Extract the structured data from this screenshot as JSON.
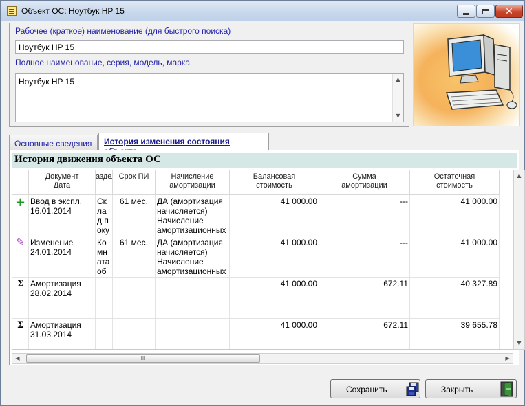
{
  "window": {
    "title": "Объект ОС: Ноутбук HP 15"
  },
  "names": {
    "short_label": "Рабочее (краткое) наименование (для быстрого поиска)",
    "short_value": "Ноутбук HP 15",
    "full_label": "Полное наименование, серия, модель, марка",
    "full_value": "Ноутбук HP 15"
  },
  "tabs": [
    {
      "label": "Основные сведения"
    },
    {
      "label": "История изменения состояния объекта"
    }
  ],
  "history": {
    "title": "История движения объекта ОС",
    "columns": [
      {
        "line1": "Документ",
        "line2": "Дата"
      },
      {
        "line1": "аздел",
        "line2": ""
      },
      {
        "line1": "Срок ПИ",
        "line2": ""
      },
      {
        "line1": "Начисление",
        "line2": "амортизации"
      },
      {
        "line1": "Балансовая",
        "line2": "стоимость"
      },
      {
        "line1": "Сумма",
        "line2": "амортизации"
      },
      {
        "line1": "Остаточная",
        "line2": "стоимость"
      }
    ],
    "rows": [
      {
        "icon": "plus-icon",
        "doc": "Ввод в экспл.",
        "date": "16.01.2014",
        "section": "Склад покупн",
        "term": "61 мес.",
        "accrual": "ДА (амортизация начисляется) Начисление амортизационных",
        "balance": "41 000.00",
        "amort": "---",
        "residual": "41 000.00"
      },
      {
        "icon": "pencil-icon",
        "doc": "Изменение",
        "date": "24.01.2014",
        "section": "Комната обр",
        "term": "61 мес.",
        "accrual": "ДА (амортизация начисляется) Начисление амортизационных",
        "balance": "41 000.00",
        "amort": "---",
        "residual": "41 000.00"
      },
      {
        "icon": "sigma-icon",
        "doc": "Амортизация",
        "date": "28.02.2014",
        "section": "",
        "term": "",
        "accrual": "",
        "balance": "41 000.00",
        "amort": "672.11",
        "residual": "40 327.89"
      },
      {
        "icon": "sigma-icon",
        "doc": "Амортизация",
        "date": "31.03.2014",
        "section": "",
        "term": "",
        "accrual": "",
        "balance": "41 000.00",
        "amort": "672.11",
        "residual": "39 655.78"
      }
    ]
  },
  "buttons": {
    "save": "Сохранить",
    "close": "Закрыть"
  }
}
